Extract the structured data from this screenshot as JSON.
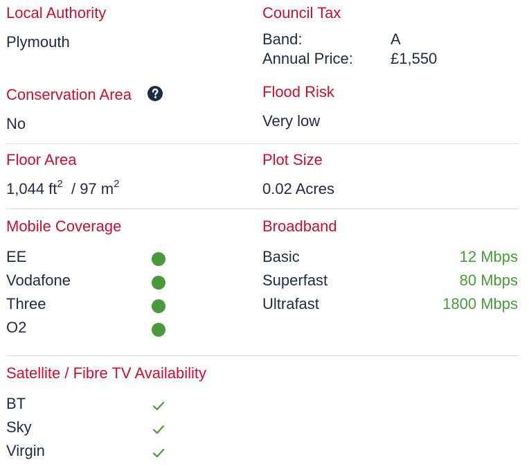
{
  "local_authority": {
    "title": "Local Authority",
    "value": "Plymouth"
  },
  "council_tax": {
    "title": "Council Tax",
    "band_label": "Band:",
    "band_value": "A",
    "price_label": "Annual Price:",
    "price_value": "£1,550"
  },
  "conservation_area": {
    "title": "Conservation Area",
    "value": "No",
    "help_icon": "question-circle-icon"
  },
  "flood_risk": {
    "title": "Flood Risk",
    "value": "Very low"
  },
  "floor_area": {
    "title": "Floor Area",
    "ft_value": "1,044 ft",
    "ft_sup": "2",
    "m_value": "/ 97 m",
    "m_sup": "2"
  },
  "plot_size": {
    "title": "Plot Size",
    "value": "0.02 Acres"
  },
  "mobile_coverage": {
    "title": "Mobile Coverage",
    "status_color": "#4a9a3c",
    "providers": [
      {
        "name": "EE"
      },
      {
        "name": "Vodafone"
      },
      {
        "name": "Three"
      },
      {
        "name": "O2"
      }
    ]
  },
  "broadband": {
    "title": "Broadband",
    "speed_color": "#4a9a3c",
    "tiers": [
      {
        "name": "Basic",
        "speed": "12 Mbps"
      },
      {
        "name": "Superfast",
        "speed": "80 Mbps"
      },
      {
        "name": "Ultrafast",
        "speed": "1800 Mbps"
      }
    ]
  },
  "tv_availability": {
    "title": "Satellite / Fibre TV Availability",
    "check_icon": "checkmark-icon",
    "providers": [
      {
        "name": "BT"
      },
      {
        "name": "Sky"
      },
      {
        "name": "Virgin"
      }
    ]
  },
  "colors": {
    "heading": "#c8102e",
    "text": "#1f2a44",
    "accent_green": "#4a9a3c",
    "divider": "#dcdcdc"
  }
}
